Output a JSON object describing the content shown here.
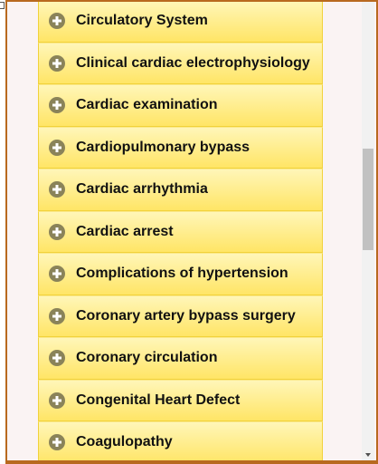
{
  "list": {
    "items": [
      {
        "label": "Circulatory System"
      },
      {
        "label": "Clinical cardiac electrophysiology"
      },
      {
        "label": "Cardiac examination"
      },
      {
        "label": "Cardiopulmonary bypass"
      },
      {
        "label": "Cardiac arrhythmia"
      },
      {
        "label": "Cardiac arrest"
      },
      {
        "label": "Complications of hypertension"
      },
      {
        "label": "Coronary artery bypass surgery"
      },
      {
        "label": "Coronary circulation"
      },
      {
        "label": "Congenital Heart Defect"
      },
      {
        "label": "Coagulopathy"
      }
    ]
  },
  "colors": {
    "frame": "#b8691f",
    "item_background_top": "#fff6b8",
    "item_background_bottom": "#ffe566",
    "item_border": "#f1d23a",
    "icon_color": "#8a8359"
  },
  "icons": {
    "item_icon": "plus-circle-icon",
    "scroll_down": "chevron-down-icon"
  }
}
